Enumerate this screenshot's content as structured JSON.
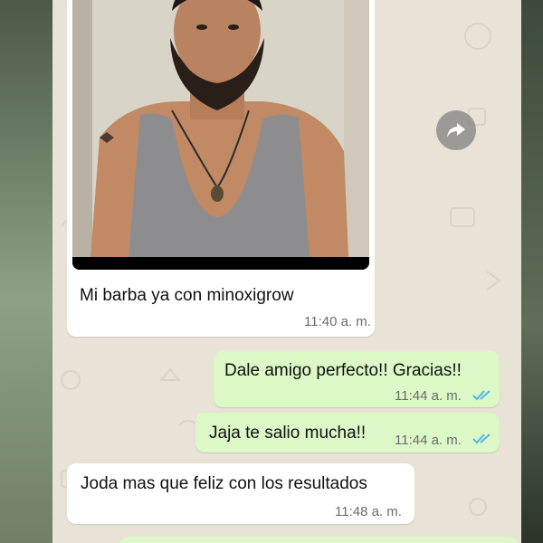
{
  "messages": [
    {
      "text": "Mi barba ya con minoxigrow",
      "time": "11:40 a. m."
    },
    {
      "text": "Dale amigo perfecto!! Gracias!!",
      "time": "11:44 a. m."
    },
    {
      "text": "Jaja te salio mucha!!",
      "time": "11:44 a. m."
    },
    {
      "text": "Joda mas que feliz con los resultados",
      "time": "11:48 a. m."
    }
  ],
  "icons": {
    "forward": "forward-icon",
    "read_receipt": "double-check-icon"
  },
  "colors": {
    "chat_background": "#e9e2d7",
    "incoming_bubble": "#ffffff",
    "outgoing_bubble": "#dcf8c6",
    "read_ticks": "#4fb6ec"
  }
}
